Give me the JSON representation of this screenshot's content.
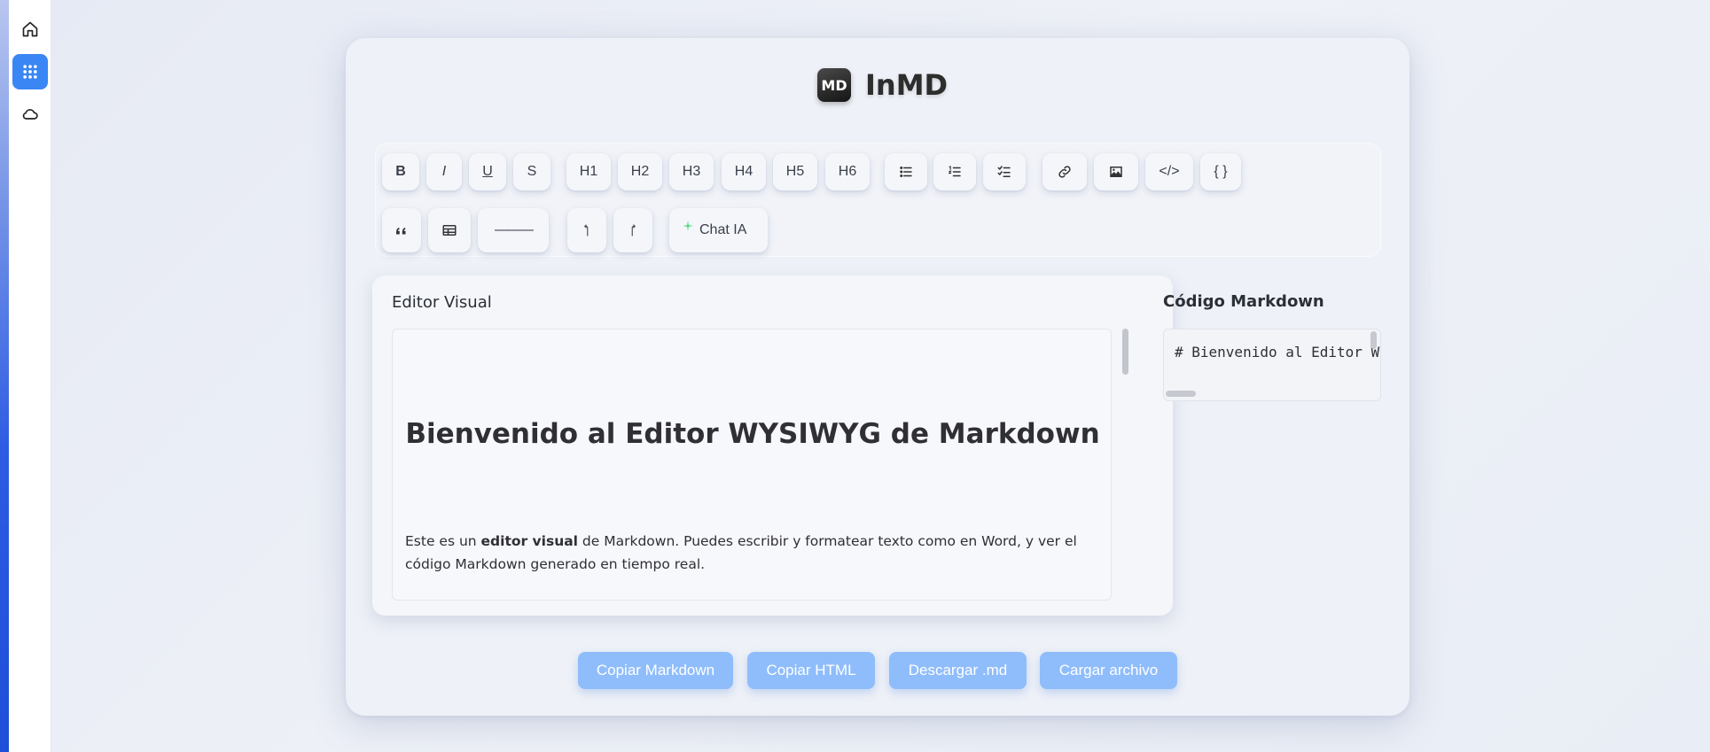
{
  "app": {
    "logo_text": "MD",
    "name": "InMD"
  },
  "sidebar": {
    "items": [
      {
        "icon": "home-icon",
        "active": false
      },
      {
        "icon": "apps-grid-icon",
        "active": true
      },
      {
        "icon": "cloud-icon",
        "active": false
      }
    ]
  },
  "toolbar": {
    "bold": "B",
    "italic": "I",
    "underline": "U",
    "strike": "S",
    "h1": "H1",
    "h2": "H2",
    "h3": "H3",
    "h4": "H4",
    "h5": "H5",
    "h6": "H6",
    "code": "</>",
    "code_block": "{ }",
    "hr": "———",
    "chat": "Chat IA"
  },
  "editor": {
    "title": "Editor Visual",
    "heading": "Bienvenido al Editor WYSIWYG de Markdown",
    "para_before": "Este es un ",
    "para_bold": "editor visual",
    "para_after": " de Markdown. Puedes escribir y formatear texto como en Word, y ver el código Markdown generado en tiempo real."
  },
  "markdown": {
    "title": "Código Markdown",
    "code": "# Bienvenido al Editor WYSIWYG de Markdown"
  },
  "actions": {
    "copy_md": "Copiar Markdown",
    "copy_html": "Copiar HTML",
    "download": "Descargar .md",
    "upload": "Cargar archivo"
  },
  "colors": {
    "accent": "#3a86f5",
    "action_button": "#8fbdfb",
    "chat_sparkle": "#4cd97b"
  }
}
